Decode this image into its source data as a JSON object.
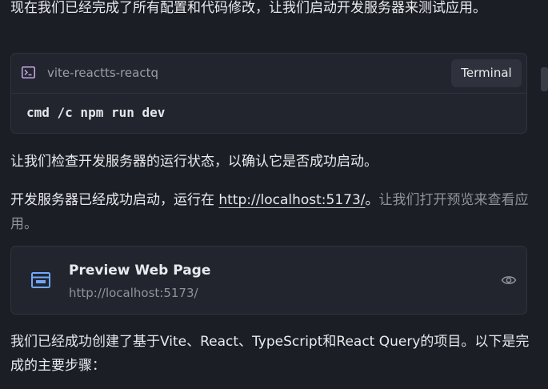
{
  "messages": {
    "intro": "现在我们已经完成了所有配置和代码修改，让我们启动开发服务器来测试应用。",
    "check_status": "让我们检查开发服务器的运行状态，以确认它是否成功启动。",
    "server_started_prefix": "开发服务器已经成功启动，运行在 ",
    "server_url": "http://localhost:5173/",
    "server_started_suffix": "。",
    "open_preview": "让我们打开预览来查看应用。",
    "summary": "我们已经成功创建了基于Vite、React、TypeScript和React Query的项目。以下是完成的主要步骤："
  },
  "terminal": {
    "icon": "terminal-icon",
    "project_name": "vite-reactts-reactq",
    "button_label": "Terminal",
    "command": "cmd /c npm run dev"
  },
  "preview": {
    "icon": "browser-window-icon",
    "title": "Preview Web Page",
    "url": "http://localhost:5173/",
    "action_icon": "eye-icon"
  },
  "colors": {
    "background": "#1c1e26",
    "card_background": "#22252e",
    "card_border": "#30333d",
    "text": "#e9eaed",
    "muted_text": "#8f939c",
    "accent": "#6ea8ff"
  }
}
